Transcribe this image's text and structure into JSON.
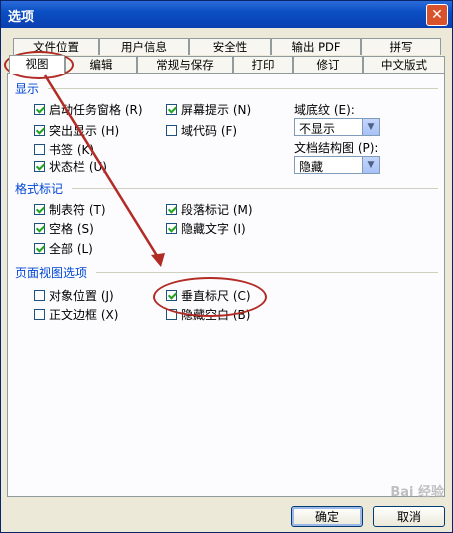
{
  "window": {
    "title": "选项",
    "close_glyph": "✕"
  },
  "tabs_row1": [
    "文件位置",
    "用户信息",
    "安全性",
    "输出 PDF",
    "拼写"
  ],
  "tabs_row2": [
    "视图",
    "编辑",
    "常规与保存",
    "打印",
    "修订",
    "中文版式"
  ],
  "sections": {
    "display": {
      "label": "显示",
      "items": [
        {
          "label": "启动任务窗格 (R)",
          "checked": true
        },
        {
          "label": "屏幕提示 (N)",
          "checked": true
        },
        {
          "label": "突出显示 (H)",
          "checked": true
        },
        {
          "label": "域代码 (F)",
          "checked": false
        },
        {
          "label": "书签 (K)",
          "checked": false
        },
        {
          "label": "状态栏 (U)",
          "checked": true
        }
      ],
      "field_shading_label": "域底纹 (E):",
      "field_shading_value": "不显示",
      "doc_map_label": "文档结构图 (P):",
      "doc_map_value": "隐藏"
    },
    "format_marks": {
      "label": "格式标记",
      "items": [
        {
          "label": "制表符 (T)",
          "checked": true
        },
        {
          "label": "段落标记 (M)",
          "checked": true
        },
        {
          "label": "空格 (S)",
          "checked": true
        },
        {
          "label": "隐藏文字 (I)",
          "checked": true
        },
        {
          "label": "全部 (L)",
          "checked": true
        }
      ]
    },
    "page_view": {
      "label": "页面视图选项",
      "items": [
        {
          "label": "对象位置 (J)",
          "checked": false
        },
        {
          "label": "垂直标尺 (C)",
          "checked": true
        },
        {
          "label": "正文边框 (X)",
          "checked": false
        },
        {
          "label": "隐藏空白 (B)",
          "checked": false
        }
      ]
    }
  },
  "buttons": {
    "ok": "确定",
    "cancel": "取消"
  },
  "watermark": "Bai 经验",
  "colors": {
    "title_bar": "#0a4fc4",
    "section_label": "#0046d5",
    "annotation": "#b22b24"
  }
}
